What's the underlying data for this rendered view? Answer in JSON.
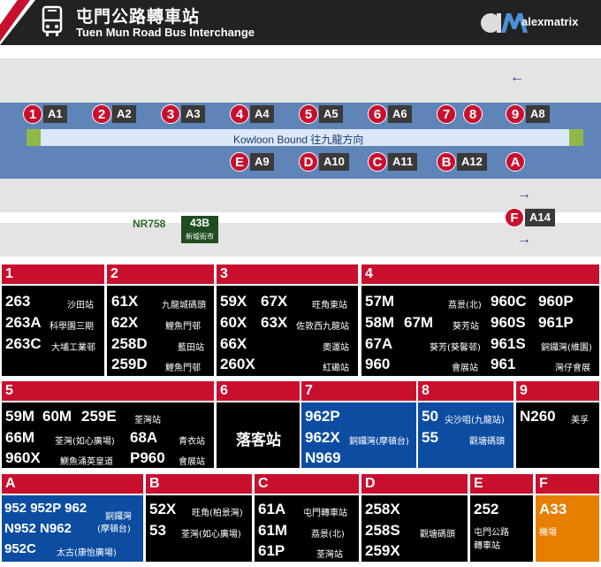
{
  "header": {
    "title_zh": "屯門公路轉車站",
    "title_en": "Tuen Mun Road Bus Interchange",
    "logo_text": "alexmatrix",
    "stripe_colors": [
      "#c8102e",
      "#ffffff"
    ]
  },
  "map": {
    "island_label": "Kowloon Bound  往九龍方向",
    "top_bays": [
      {
        "badge": "1",
        "tag": "A1"
      },
      {
        "badge": "2",
        "tag": "A2"
      },
      {
        "badge": "3",
        "tag": "A3"
      },
      {
        "badge": "4",
        "tag": "A4"
      },
      {
        "badge": "5",
        "tag": "A5"
      },
      {
        "badge": "6",
        "tag": "A6"
      },
      {
        "badge": "7",
        "tag": ""
      },
      {
        "badge": "8",
        "tag": ""
      },
      {
        "badge": "9",
        "tag": "A8"
      }
    ],
    "bottom_bays": [
      {
        "badge": "E",
        "tag": "A9"
      },
      {
        "badge": "D",
        "tag": "A10"
      },
      {
        "badge": "C",
        "tag": "A11"
      },
      {
        "badge": "B",
        "tag": "A12"
      },
      {
        "badge": "A",
        "tag": ""
      }
    ],
    "f_bay": {
      "badge": "F",
      "tag": "A14"
    },
    "arrow_left": "←",
    "arrow_right": "→",
    "nr_label": "NR758",
    "stop_43b": {
      "route": "43B",
      "dest": "新墟街市"
    }
  },
  "panels": [
    {
      "id": "1",
      "head_color": "#c8102e",
      "body_color": "#000000",
      "routes": [
        {
          "route": "263",
          "dest": "沙田站"
        },
        {
          "route": "263A",
          "dest": "科學園三期"
        },
        {
          "route": "263C",
          "dest": "大埔工業邨"
        }
      ]
    },
    {
      "id": "2",
      "head_color": "#c8102e",
      "body_color": "#000000",
      "routes": [
        {
          "route": "61X",
          "dest": "九龍城碼頭"
        },
        {
          "route": "62X",
          "dest": "鯉魚門邨"
        },
        {
          "route": "258D",
          "dest": "藍田站"
        },
        {
          "route": "259D",
          "dest": "鯉魚門邨"
        }
      ]
    },
    {
      "id": "3",
      "head_color": "#c8102e",
      "body_color": "#000000",
      "routes": [
        {
          "route": "59X",
          "route2": "67X",
          "dest": "旺角東站"
        },
        {
          "route": "60X",
          "route2": "63X",
          "dest": "佐敦西九龍站"
        },
        {
          "route": "66X",
          "dest": "奧運站"
        },
        {
          "route": "260X",
          "dest": "紅磡站"
        }
      ]
    },
    {
      "id": "4",
      "head_color": "#c8102e",
      "body_color": "#000000",
      "routes": [
        {
          "route": "57M",
          "dest": "荔景(北)"
        },
        {
          "route": "58M",
          "route2": "67M",
          "dest": "葵芳站"
        },
        {
          "route": "67A",
          "dest": "葵芳(葵馨邨)"
        },
        {
          "route": "960",
          "dest": "會展站"
        },
        {
          "route": "960C",
          "route2": "960P"
        },
        {
          "route": "960S",
          "route2": "961P"
        },
        {
          "route": "961S",
          "dest": "銅鑼灣(維園)"
        },
        {
          "route": "961",
          "dest": "灣仔會展"
        }
      ]
    },
    {
      "id": "5",
      "head_color": "#c8102e",
      "body_color": "#000000",
      "routes": [
        {
          "route": "59M",
          "route2": "60M",
          "route3": "259E",
          "dest": "荃灣站"
        },
        {
          "route": "66M",
          "dest": "荃灣(如心廣場)"
        },
        {
          "route": "960X",
          "dest": "鰂魚涌英皇道"
        },
        {
          "route": "68A",
          "dest": "青衣站"
        },
        {
          "route": "P960",
          "dest": "會展站"
        }
      ]
    },
    {
      "id": "6",
      "head_color": "#c8102e",
      "body_color": "#000000",
      "routes": [
        {
          "route": "落客站"
        }
      ]
    },
    {
      "id": "7",
      "head_color": "#c8102e",
      "body_color": "#0c4da2",
      "routes": [
        {
          "route": "962P"
        },
        {
          "route": "962X",
          "dest": "銅鑼灣(摩頓台)"
        },
        {
          "route": "N969"
        }
      ]
    },
    {
      "id": "8",
      "head_color": "#c8102e",
      "body_color": "#0c4da2",
      "routes": [
        {
          "route": "50",
          "dest": "尖沙咀(九龍站)"
        },
        {
          "route": "55",
          "dest": "觀塘碼頭"
        }
      ]
    },
    {
      "id": "9",
      "head_color": "#c8102e",
      "body_color": "#000000",
      "routes": [
        {
          "route": "N260",
          "dest": "美孚"
        }
      ]
    },
    {
      "id": "A",
      "head_color": "#c8102e",
      "body_color": "#0c4da2",
      "routes": [
        {
          "route": "952 952P 962"
        },
        {
          "route": "N952 N962"
        },
        {
          "route": "952C",
          "dest": "太古(康怡廣場)"
        },
        {
          "dest": "銅鑼灣"
        },
        {
          "dest": "(摩頓台)"
        }
      ]
    },
    {
      "id": "B",
      "head_color": "#c8102e",
      "body_color": "#000000",
      "routes": [
        {
          "route": "52X",
          "dest": "旺角(柏景灣)"
        },
        {
          "route": "53",
          "dest": "荃灣(如心廣場)"
        }
      ]
    },
    {
      "id": "C",
      "head_color": "#c8102e",
      "body_color": "#000000",
      "routes": [
        {
          "route": "61A",
          "dest": "屯門轉車站"
        },
        {
          "route": "61M",
          "dest": "荔景(北)"
        },
        {
          "route": "61P",
          "dest": "荃灣站"
        }
      ]
    },
    {
      "id": "D",
      "head_color": "#c8102e",
      "body_color": "#000000",
      "routes": [
        {
          "route": "258X"
        },
        {
          "route": "258S",
          "dest": "觀塘碼頭"
        },
        {
          "route": "259X"
        }
      ]
    },
    {
      "id": "E",
      "head_color": "#c8102e",
      "body_color": "#000000",
      "routes": [
        {
          "route": "252"
        },
        {
          "dest": "屯門公路"
        },
        {
          "dest": "轉車站"
        }
      ]
    },
    {
      "id": "F",
      "head_color": "#c8102e",
      "body_color": "#e67e00",
      "routes": [
        {
          "route": "A33"
        },
        {
          "dest": "機場"
        }
      ]
    }
  ]
}
